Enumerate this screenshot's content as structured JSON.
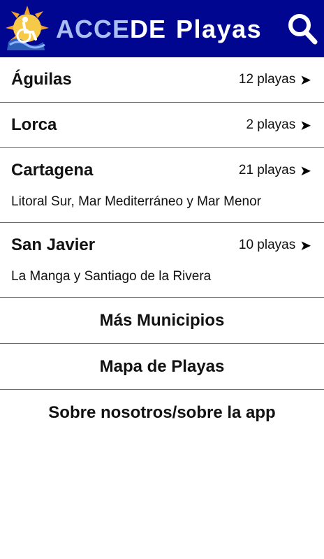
{
  "header": {
    "brand_part1": "ACCE",
    "brand_part2": "DE",
    "brand_part3": "Playas"
  },
  "municipios": [
    {
      "name": "Águilas",
      "count": "12 playas",
      "subtitle": ""
    },
    {
      "name": "Lorca",
      "count": "2 playas",
      "subtitle": ""
    },
    {
      "name": "Cartagena",
      "count": "21 playas",
      "subtitle": "Litoral Sur, Mar Mediterráneo y Mar Menor"
    },
    {
      "name": "San Javier",
      "count": "10 playas",
      "subtitle": "La Manga y Santiago de la Rivera"
    }
  ],
  "links": {
    "more": "Más Municipios",
    "map": "Mapa de Playas",
    "about": "Sobre nosotros/sobre la app"
  },
  "icons": {
    "arrow": "➤",
    "search": "search-icon",
    "logo": "accessibility-logo-icon"
  },
  "colors": {
    "header_bg": "#00068f",
    "brand_light": "#a9bff2"
  }
}
